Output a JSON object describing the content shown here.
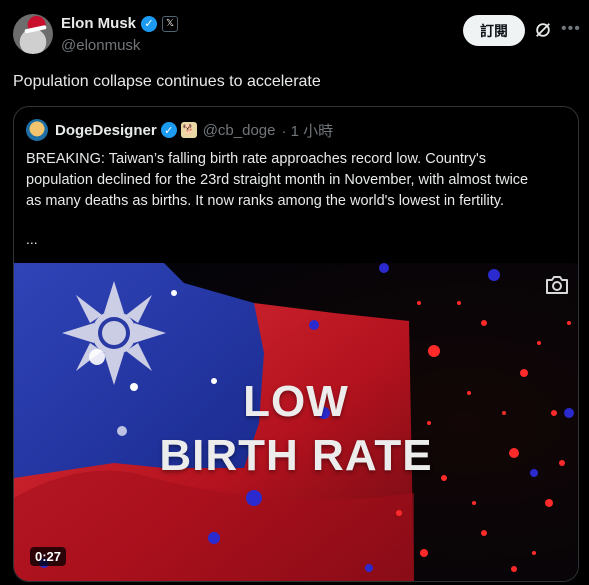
{
  "tweet": {
    "author_name": "Elon Musk",
    "handle": "@elonmusk",
    "affiliate_badge": "𝕏",
    "subscribe_label": "訂閱",
    "text": "Population collapse continues to accelerate"
  },
  "quote": {
    "author_name": "DogeDesigner",
    "handle": "@cb_doge",
    "time": "· 1 小時",
    "text": "BREAKING: Taiwan’s falling birth rate approaches record low. Country's population declined for the 23rd straight month in November, with almost twice as many deaths as births. It now ranks among the world's lowest in fertility.",
    "more": "...",
    "media": {
      "overlay_line1": "LOW",
      "overlay_line2": "BIRTH RATE",
      "duration": "0:27"
    }
  },
  "colors": {
    "background": "#000000",
    "verified_blue": "#1d9bf0",
    "flag_red": "#d81b2a",
    "flag_blue": "#1a2a8f"
  },
  "icons": [
    "verified-icon",
    "x-affiliate-icon",
    "grok-icon",
    "more-icon",
    "camera-icon",
    "gold-badge-icon"
  ]
}
